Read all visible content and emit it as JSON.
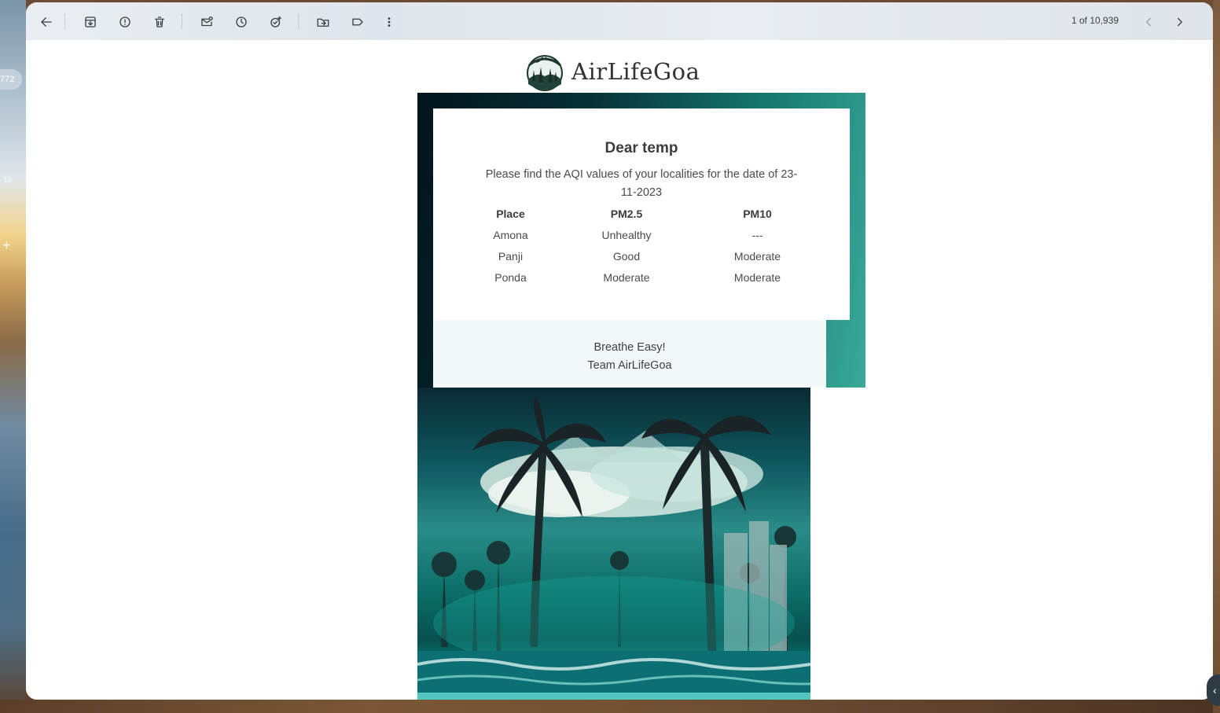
{
  "desktop": {
    "left_badge": "772",
    "left_small": "18",
    "left_plus": "+"
  },
  "toolbar": {
    "back_label": "Back",
    "pager_text": "1 of 10,939"
  },
  "email": {
    "brand": "AirLifeGoa",
    "greeting": "Dear temp",
    "intro": "Please find the AQI values of your localities for the date of 23-11-2023",
    "table": {
      "headers": [
        "Place",
        "PM2.5",
        "PM10"
      ],
      "rows": [
        {
          "place": "Amona",
          "pm25": "Unhealthy",
          "pm10": "---"
        },
        {
          "place": "Panji",
          "pm25": "Good",
          "pm10": "Moderate"
        },
        {
          "place": "Ponda",
          "pm25": "Moderate",
          "pm10": "Moderate"
        }
      ]
    },
    "signoff_line1": "Breathe Easy!",
    "signoff_line2": "Team AirLifeGoa"
  },
  "colors": {
    "unhealthy": "#e0602f",
    "good": "#1ccfa9",
    "moderate": "#e6ee8e",
    "banner_start": "#02141c",
    "banner_end": "#3aa99a"
  }
}
